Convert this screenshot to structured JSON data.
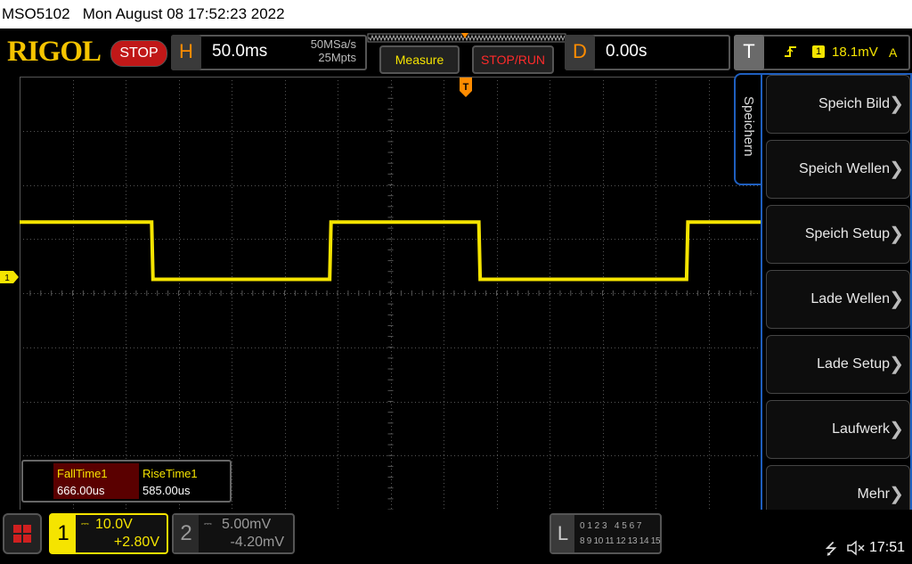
{
  "title_bar": {
    "model": "MSO5102",
    "datetime": "Mon August 08 17:52:23 2022"
  },
  "brand": {
    "logo": "RIGOL",
    "run_status": "STOP"
  },
  "horizontal": {
    "letter": "H",
    "timebase": "50.0ms",
    "sample_rate": "50MSa/s",
    "memory_depth": "25Mpts"
  },
  "toolbar": {
    "measure_label": "Measure",
    "stop_run_label": "STOP/RUN"
  },
  "delay": {
    "letter": "D",
    "value": "0.00s"
  },
  "trigger": {
    "letter": "T",
    "channel": "1",
    "level": "18.1mV",
    "mode": "A"
  },
  "right_menu": {
    "tab_label": "Speichern",
    "items": [
      {
        "label": "Speich Bild"
      },
      {
        "label": "Speich Wellen"
      },
      {
        "label": "Speich Setup"
      },
      {
        "label": "Lade Wellen"
      },
      {
        "label": "Lade Setup"
      },
      {
        "label": "Laufwerk"
      },
      {
        "label": "Mehr"
      }
    ]
  },
  "channel_marker": "1",
  "trigger_marker": "T",
  "measurements": [
    {
      "name": "FallTime1",
      "value": "666.00us"
    },
    {
      "name": "RiseTime1",
      "value": "585.00us"
    }
  ],
  "channels": [
    {
      "number": "1",
      "scale": "10.0V",
      "offset": "+2.80V",
      "color": "#f5e400"
    },
    {
      "number": "2",
      "scale": "5.00mV",
      "offset": "-4.20mV",
      "color": "#9a9a9a"
    }
  ],
  "la": {
    "letter": "L",
    "row1": "0 1 2 3   4 5 6 7",
    "row2": "8 9 10 11 12 13 14 15"
  },
  "status": {
    "time": "17:51"
  },
  "colors": {
    "ch1": "#f5e400",
    "accent_orange": "#ff8c00",
    "stop_red": "#c01818",
    "tab_blue": "#1f5fbf"
  },
  "waveform": {
    "high_level_frac": 0.336,
    "low_level_frac": 0.468,
    "transitions_frac": [
      0.178,
      0.418,
      0.619,
      0.899
    ]
  }
}
